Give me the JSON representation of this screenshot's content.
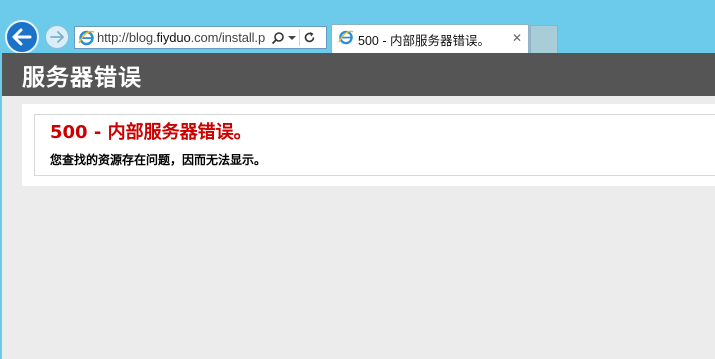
{
  "browser": {
    "address_url": "http://blog.fiyduo.com/install.p",
    "address_domain": "fiyduo",
    "tab_title": "500 - 内部服务器错误。",
    "icons": {
      "back": "back-arrow-icon",
      "forward": "forward-arrow-icon",
      "site": "ie-logo-icon",
      "search": "search-icon",
      "dropdown": "dropdown-icon",
      "refresh": "refresh-icon",
      "close": "close-icon"
    },
    "colors": {
      "frame": "#6ccbea",
      "back_button": "#1a72c9"
    }
  },
  "page": {
    "header_title": "服务器错误",
    "error_title": "500 - 内部服务器错误。",
    "error_description": "您查找的资源存在问题，因而无法显示。",
    "colors": {
      "header_bg": "#555555",
      "error_title": "#cc0000",
      "page_bg": "#ececec"
    }
  }
}
